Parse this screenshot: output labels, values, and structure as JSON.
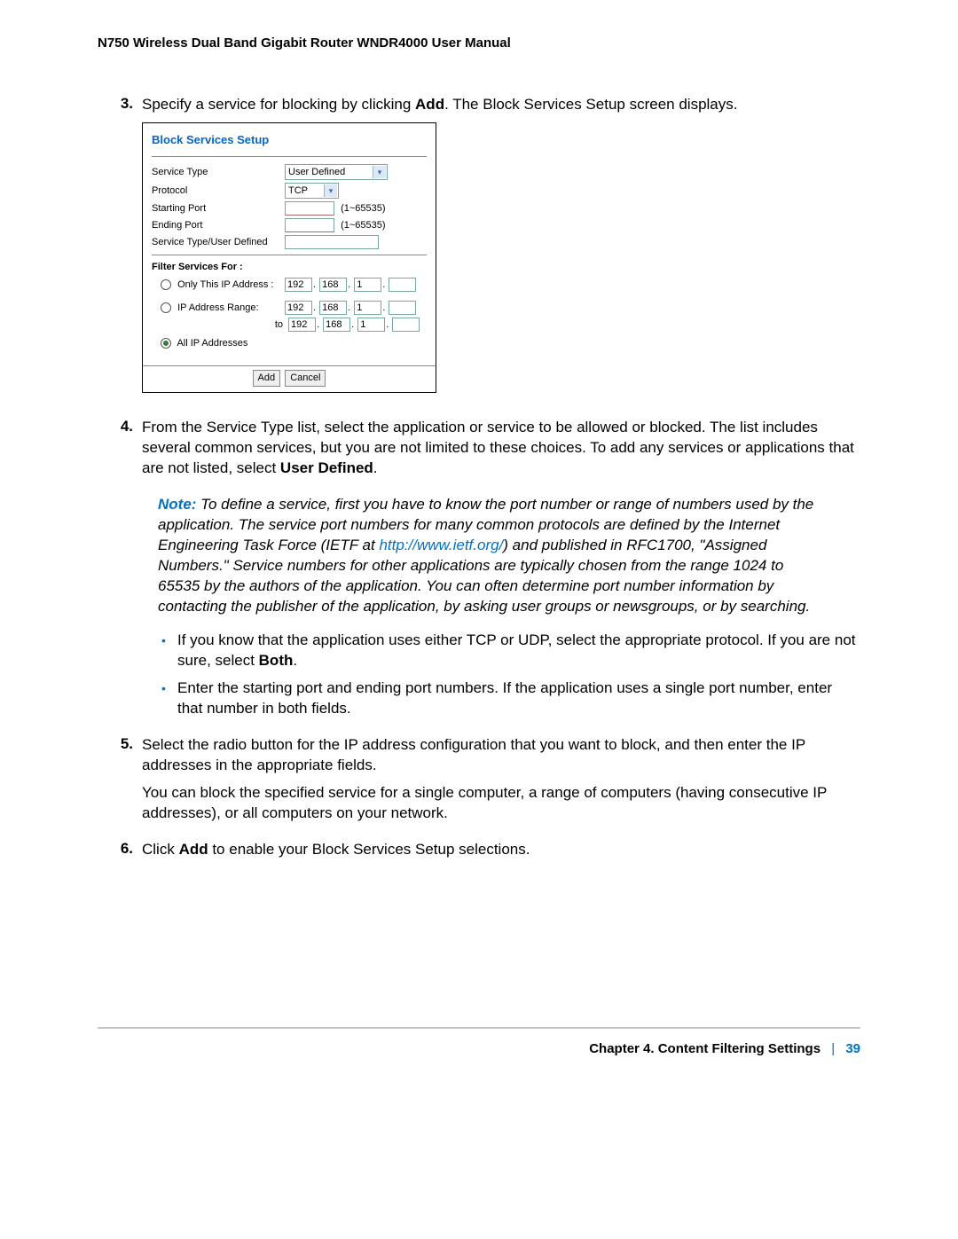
{
  "header": {
    "title": "N750 Wireless Dual Band Gigabit Router WNDR4000 User Manual"
  },
  "steps": {
    "s3": {
      "num": "3.",
      "pre": "Specify a service for blocking by clicking ",
      "bold": "Add",
      "post": ". The Block Services Setup screen displays."
    },
    "s4": {
      "num": "4.",
      "text_pre": "From the Service Type list, select the application or service to be allowed or blocked. The list includes several common services, but you are not limited to these choices. To add any services or applications that are not listed, select ",
      "bold": "User Defined",
      "text_post": "."
    },
    "note": {
      "label": "Note:",
      "part1": "  To define a service, first you have to know the port number or range of numbers used by the application. The service port numbers for many common protocols are defined by the Internet Engineering Task Force ",
      "ietf_paren_pre": "(IETF at ",
      "link": "http://www.ietf.org/",
      "part2": ") and published in RFC1700, \"Assigned Numbers.\" Service numbers for other applications are typically chosen from the range 1024 to 65535 by the authors of the application. You can often determine port number information by contacting the publisher of the application, by asking user groups or newsgroups, or by searching."
    },
    "bullets": [
      {
        "pre": "If you know that the application uses either TCP or UDP, select the appropriate protocol. If you are not sure, select ",
        "bold": "Both",
        "post": "."
      },
      {
        "pre": "Enter the starting port and ending port numbers. If the application uses a single port number, enter that number in both fields.",
        "bold": "",
        "post": ""
      }
    ],
    "s5": {
      "num": "5.",
      "p1": "Select the radio button for the IP address configuration that you want to block, and then enter the IP addresses in the appropriate fields.",
      "p2": "You can block the specified service for a single computer, a range of computers (having consecutive IP addresses), or all computers on your network."
    },
    "s6": {
      "num": "6.",
      "pre": "Click ",
      "bold": "Add",
      "post": " to enable your Block Services Setup selections."
    }
  },
  "screenshot": {
    "title": "Block Services Setup",
    "rows": {
      "service_type": {
        "label": "Service Type",
        "value": "User Defined"
      },
      "protocol": {
        "label": "Protocol",
        "value": "TCP"
      },
      "starting_port": {
        "label": "Starting Port",
        "hint": "(1~65535)"
      },
      "ending_port": {
        "label": "Ending Port",
        "hint": "(1~65535)"
      },
      "user_defined": {
        "label": "Service Type/User Defined"
      }
    },
    "filter": {
      "title": "Filter Services For :",
      "only_this": {
        "label": "Only This IP Address :",
        "ip": [
          "192",
          "168",
          "1",
          ""
        ]
      },
      "range": {
        "label": "IP Address Range:",
        "ip_from": [
          "192",
          "168",
          "1",
          ""
        ],
        "to_label": "to",
        "ip_to": [
          "192",
          "168",
          "1",
          ""
        ]
      },
      "all": {
        "label": "All IP Addresses"
      }
    },
    "buttons": {
      "add": "Add",
      "cancel": "Cancel"
    }
  },
  "footer": {
    "chapter": "Chapter 4.  Content Filtering Settings",
    "bar": "|",
    "page": "39"
  }
}
